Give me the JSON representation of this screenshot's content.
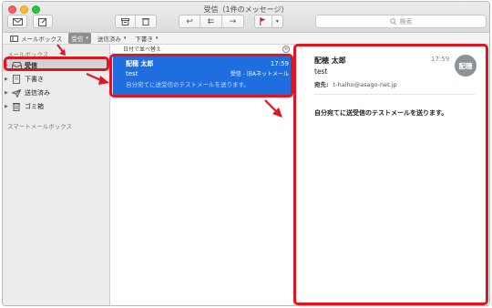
{
  "window": {
    "title": "受信（1件のメッセージ）"
  },
  "toolbar": {
    "search_placeholder": "検索"
  },
  "favorites": {
    "mailboxes": "メールボックス",
    "inbox": "受信",
    "sent": "送信済み",
    "drafts": "下書き"
  },
  "sidebar": {
    "section_mailboxes": "メールボックス",
    "items": [
      {
        "label": "受信",
        "icon": "inbox-icon"
      },
      {
        "label": "下書き",
        "icon": "draft-icon"
      },
      {
        "label": "送信済み",
        "icon": "paper-plane-icon"
      },
      {
        "label": "ゴミ箱",
        "icon": "trash-icon"
      }
    ],
    "section_smart": "スマートメールボックス"
  },
  "list": {
    "sort_label": "日付で並べ替え",
    "message": {
      "from": "配穂 太郎",
      "time": "17:59",
      "subject": "test",
      "mailbox": "受信 - 旧Aネットメール",
      "preview": "自分宛てに送受信のテストメールを送ります。"
    }
  },
  "reader": {
    "from": "配穂 太郎",
    "time": "17:59",
    "avatar": "配穂",
    "subject": "test",
    "to_label": "宛先:",
    "to": "t-haiho@asago-net.jp",
    "body": "自分宛てに送受信のテストメールを送ります。"
  },
  "colors": {
    "selection": "#1e6ee0",
    "annotation": "#e0151f"
  }
}
